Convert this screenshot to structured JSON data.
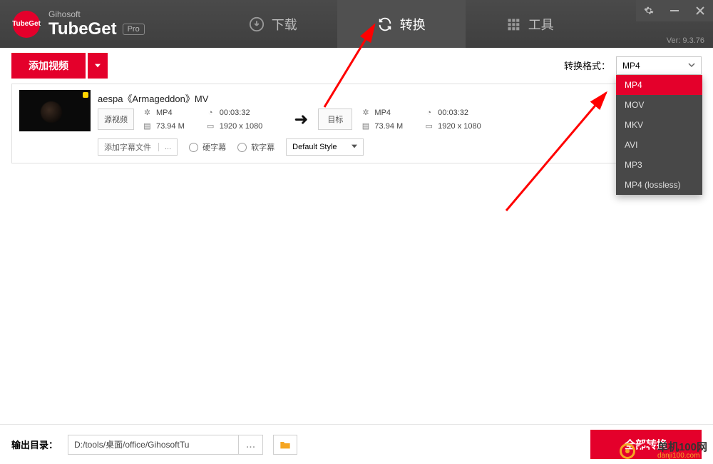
{
  "header": {
    "company": "Gihosoft",
    "product": "TubeGet",
    "edition": "Pro",
    "version": "Ver: 9.3.76",
    "nav": {
      "download": "下载",
      "convert": "转换",
      "tools": "工具"
    }
  },
  "toolstrip": {
    "add_video": "添加视频",
    "format_label": "转换格式：",
    "format_selected": "MP4",
    "format_options": [
      "MP4",
      "MOV",
      "MKV",
      "AVI",
      "MP3",
      "MP4 (lossless)"
    ]
  },
  "item": {
    "title": "aespa《Armageddon》MV",
    "source_tag": "源视频",
    "target_tag": "目标",
    "source": {
      "format": "MP4",
      "duration": "00:03:32",
      "size": "73.94 M",
      "resolution": "1920 x 1080"
    },
    "target": {
      "format": "MP4",
      "duration": "00:03:32",
      "size": "73.94 M",
      "resolution": "1920 x 1080"
    },
    "subtitle_input": "添加字幕文件",
    "subtitle_browse": "...",
    "radio_hard": "硬字幕",
    "radio_soft": "软字幕",
    "style_select": "Default Style"
  },
  "footer": {
    "out_label": "输出目录：",
    "out_path": "D:/tools/桌面/office/GihosoftTu",
    "out_browse": "...",
    "convert_all": "全部转换"
  },
  "watermark": {
    "cn": "单机100网",
    "en": "danji100.com"
  }
}
